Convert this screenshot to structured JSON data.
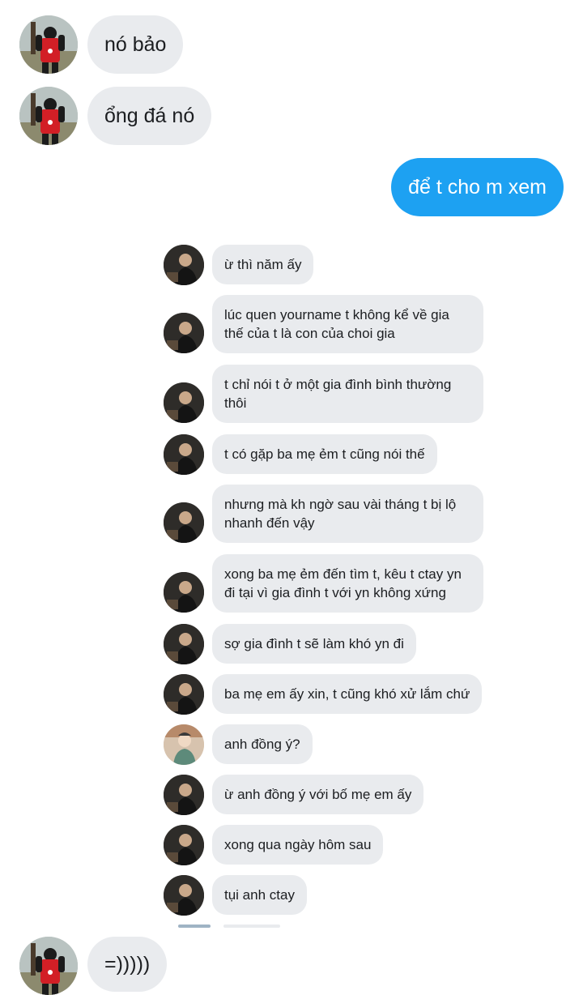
{
  "outer_messages": [
    {
      "sender": "received",
      "text": "nó bảo"
    },
    {
      "sender": "received",
      "text": "ổng đá nó"
    },
    {
      "sender": "sent",
      "text": "để t cho m xem"
    },
    {
      "sender": "received",
      "text": "=)))))"
    }
  ],
  "shared_screenshot": {
    "messages": [
      {
        "avatar": "dark",
        "text": "ừ thì năm ấy"
      },
      {
        "avatar": "dark",
        "text": "lúc quen yourname t không kể về gia thế của t là con của choi gia"
      },
      {
        "avatar": "dark",
        "text": "t chỉ nói t ở một gia đình bình thường thôi"
      },
      {
        "avatar": "dark",
        "text": "t có gặp ba mẹ ẻm t cũng nói thế"
      },
      {
        "avatar": "dark",
        "text": "nhưng mà kh ngờ sau vài tháng t bị lộ nhanh đến vậy"
      },
      {
        "avatar": "dark",
        "text": "xong ba mẹ ẻm đến tìm t, kêu t ctay yn đi tại vì gia đình t với yn không xứng"
      },
      {
        "avatar": "dark",
        "text": "sợ gia đình t sẽ làm khó yn đi"
      },
      {
        "avatar": "dark",
        "text": "ba mẹ em ấy xin, t cũng khó xử lắm chứ"
      },
      {
        "avatar": "light",
        "text": "anh đồng ý?"
      },
      {
        "avatar": "dark",
        "text": "ừ anh đồng ý với bố mẹ em ấy"
      },
      {
        "avatar": "dark",
        "text": "xong qua ngày hôm sau"
      },
      {
        "avatar": "dark",
        "text": "tụi anh ctay"
      }
    ]
  },
  "colors": {
    "received_bubble": "#e9ebee",
    "sent_bubble": "#1da1f2",
    "sent_text": "#ffffff"
  },
  "icons": {
    "outer_avatar": "avatar-red-jersey-icon",
    "inner_avatar_dark": "avatar-dark-person-icon",
    "inner_avatar_light": "avatar-light-person-icon"
  }
}
